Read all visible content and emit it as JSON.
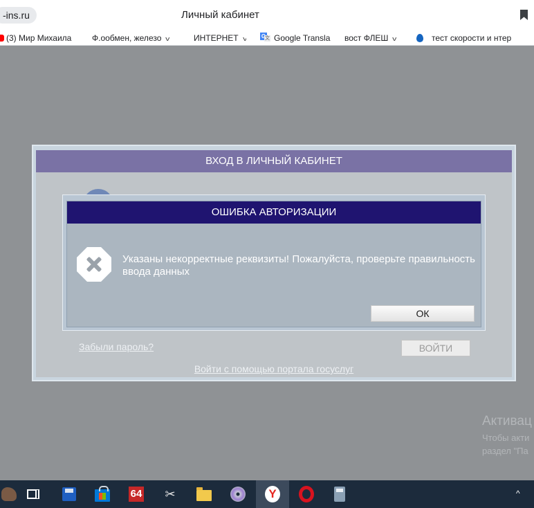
{
  "browser": {
    "url_display": "-ins.ru",
    "page_title": "Личный кабинет",
    "bookmarks": [
      {
        "label": "(3) Мир Михаила",
        "icon": "youtube-icon"
      },
      {
        "label": "Ф.ообмен, железо",
        "icon": "folder",
        "dropdown": true
      },
      {
        "label": "ИНТЕРНЕТ",
        "icon": "folder",
        "dropdown": true
      },
      {
        "label": "Google Transla",
        "icon": "google-translate-icon"
      },
      {
        "label": "вост ФЛЕШ",
        "icon": "folder",
        "dropdown": true
      },
      {
        "label": "тест скорости и нтер",
        "icon": "speedtest-drop-icon"
      }
    ]
  },
  "login": {
    "title": "ВХОД В ЛИЧНЫЙ КАБИНЕТ",
    "forgot_label": "Забыли пароль?",
    "enter_label": "ВОЙТИ",
    "gosuslugi_label": "Войти с помощью портала госуслуг"
  },
  "dialog": {
    "title": "ОШИБКА АВТОРИЗАЦИИ",
    "message": "Указаны некорректные реквизиты! Пожалуйста, проверьте правильность ввода данных",
    "ok_label": "ОК",
    "icon": "error-x-icon"
  },
  "watermark": {
    "title": "Активац",
    "line1": "Чтобы акти",
    "line2": "раздел \"Па"
  },
  "taskbar": {
    "items": [
      {
        "name": "start-button",
        "icon": "start-icon"
      },
      {
        "name": "task-view-button",
        "icon": "task-view-icon"
      },
      {
        "name": "save-app",
        "icon": "floppy-icon"
      },
      {
        "name": "store-app",
        "icon": "store-icon"
      },
      {
        "name": "aida64-app",
        "icon": "aida64-icon",
        "text": "64"
      },
      {
        "name": "snipping-app",
        "icon": "scissors-icon"
      },
      {
        "name": "explorer-app",
        "icon": "folder-icon"
      },
      {
        "name": "media-app",
        "icon": "disc-icon"
      },
      {
        "name": "yandex-browser-app",
        "icon": "yandex-icon",
        "text": "Y",
        "active": true
      },
      {
        "name": "opera-app",
        "icon": "opera-icon"
      },
      {
        "name": "calculator-app",
        "icon": "calculator-icon"
      }
    ],
    "tray_arrow": "^"
  }
}
